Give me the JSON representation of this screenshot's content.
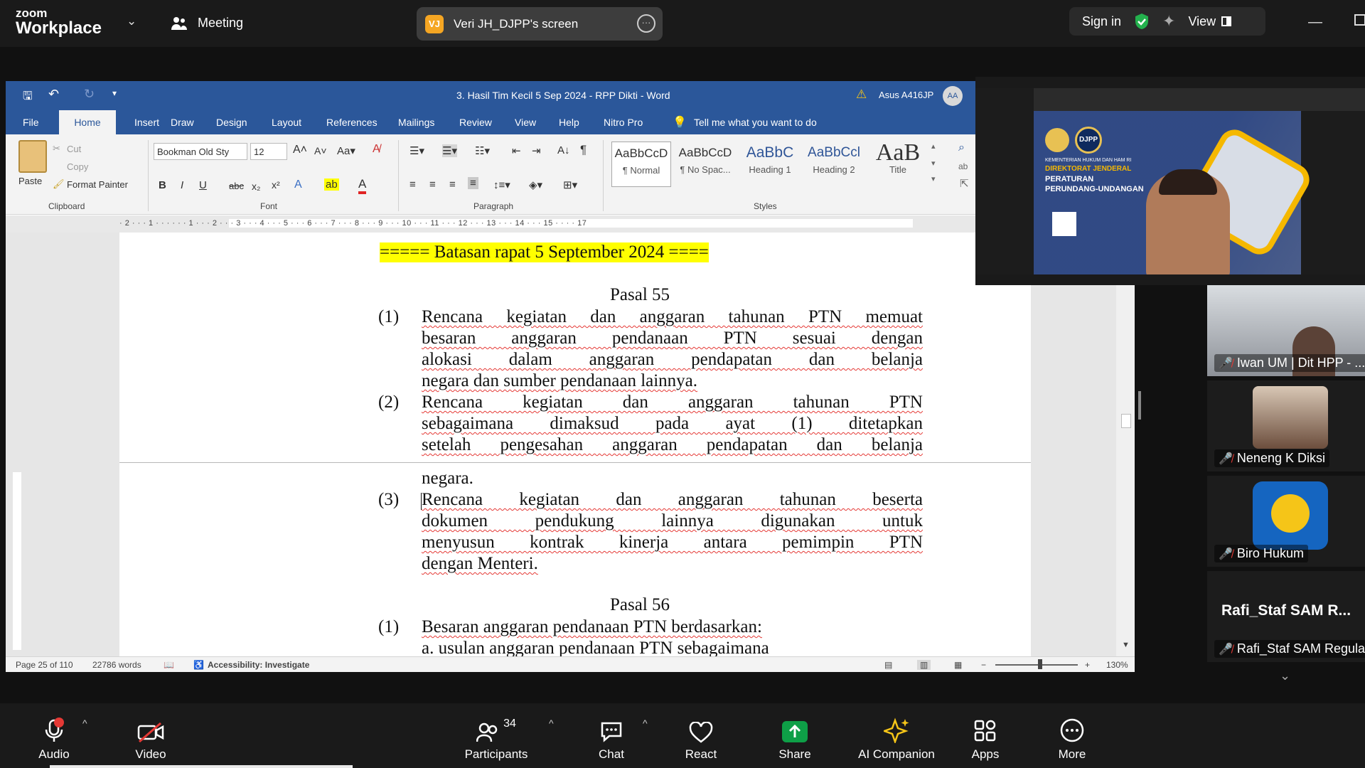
{
  "zoom": {
    "logo_line1": "zoom",
    "logo_line2": "Workplace",
    "meeting_label": "Meeting",
    "share_initials": "VJ",
    "share_label": "Veri JH_DJPP's screen",
    "signin_label": "Sign in",
    "view_label": "View",
    "colors": {
      "bar": "#1a1a1a",
      "pill": "#3d3d3d",
      "share_green": "#0e9f47",
      "mic_red": "#e53935"
    }
  },
  "word": {
    "title": "3. Hasil Tim Kecil 5 Sep 2024 - RPP Dikti  -  Word",
    "user": "Asus A416JP",
    "user_initials": "AA",
    "tabs": [
      "File",
      "Home",
      "Insert",
      "Draw",
      "Design",
      "Layout",
      "References",
      "Mailings",
      "Review",
      "View",
      "Help",
      "Nitro Pro"
    ],
    "tell_me": "Tell me what you want to do",
    "clipboard": {
      "paste": "Paste",
      "cut": "Cut",
      "copy": "Copy",
      "format_painter": "Format Painter",
      "label": "Clipboard"
    },
    "font": {
      "name": "Bookman Old Sty",
      "size": "12",
      "label": "Font"
    },
    "paragraph_label": "Paragraph",
    "styles": [
      {
        "preview": "AaBbCcD",
        "name": "¶ Normal"
      },
      {
        "preview": "AaBbCcD",
        "name": "¶ No Spac..."
      },
      {
        "preview": "AaBbC",
        "name": "Heading 1"
      },
      {
        "preview": "AaBbCcl",
        "name": "Heading 2"
      },
      {
        "preview": "AaB",
        "name": "Title"
      }
    ],
    "styles_label": "Styles",
    "ruler": "· 2 · · · 1 · · ·          · · · 1 · · · 2 · · · 3 · · · 4 · · · 5 · · · 6 · · · 7 · · · 8 · · · 9 · · · 10 · · · 11 · · · 12 · · · 13 · · · 14 · · · 15 · · ·         · 17",
    "status": {
      "page": "Page 25 of 110",
      "words": "22786 words",
      "accessibility": "Accessibility: Investigate",
      "zoom": "130%"
    }
  },
  "document": {
    "banner": "===== Batasan rapat 5 September 2024 ====",
    "pasal55": "Pasal 55",
    "p1_num": "(1)",
    "p1_lines": [
      "Rencana kegiatan dan anggaran tahunan PTN memuat",
      "besaran anggaran pendanaan PTN sesuai dengan",
      "alokasi dalam anggaran pendapatan dan belanja",
      "negara dan sumber pendanaan lainnya."
    ],
    "p2_num": "(2)",
    "p2_lines": [
      "Rencana kegiatan dan anggaran tahunan PTN",
      "sebagaimana dimaksud pada ayat (1) ditetapkan",
      "setelah pengesahan anggaran pendapatan dan belanja",
      "negara."
    ],
    "p3_num": "(3)",
    "p3_lines": [
      "Rencana kegiatan dan anggaran tahunan beserta",
      "dokumen pendukung lainnya digunakan untuk",
      "menyusun kontrak kinerja antara pemimpin PTN",
      "dengan Menteri."
    ],
    "pasal56": "Pasal 56",
    "p56_1_num": "(1)",
    "p56_1_line": "Besaran anggaran pendanaan PTN berdasarkan:",
    "p56_a_line": "a.    usulan anggaran pendanaan PTN sebagaimana"
  },
  "shared_thumb": {
    "org_line1": "KEMENTERIAN HUKUM DAN HAM RI",
    "org_line2": "DIREKTORAT JENDERAL",
    "org_line3": "PERATURAN",
    "org_line4": "PERUNDANG-UNDANGAN",
    "badge": "DJPP"
  },
  "participants": [
    {
      "name": "Iwan UM | Dit HPP - ..."
    },
    {
      "name": "Neneng K Diksi"
    },
    {
      "name": "Biro Hukum"
    },
    {
      "name": "Rafi_Staf SAM Regulasi",
      "big_name": "Rafi_Staf SAM R..."
    }
  ],
  "toolbar": {
    "audio": "Audio",
    "video": "Video",
    "participants": "Participants",
    "participants_count": "34",
    "chat": "Chat",
    "react": "React",
    "share": "Share",
    "ai": "AI Companion",
    "apps": "Apps",
    "more": "More"
  }
}
